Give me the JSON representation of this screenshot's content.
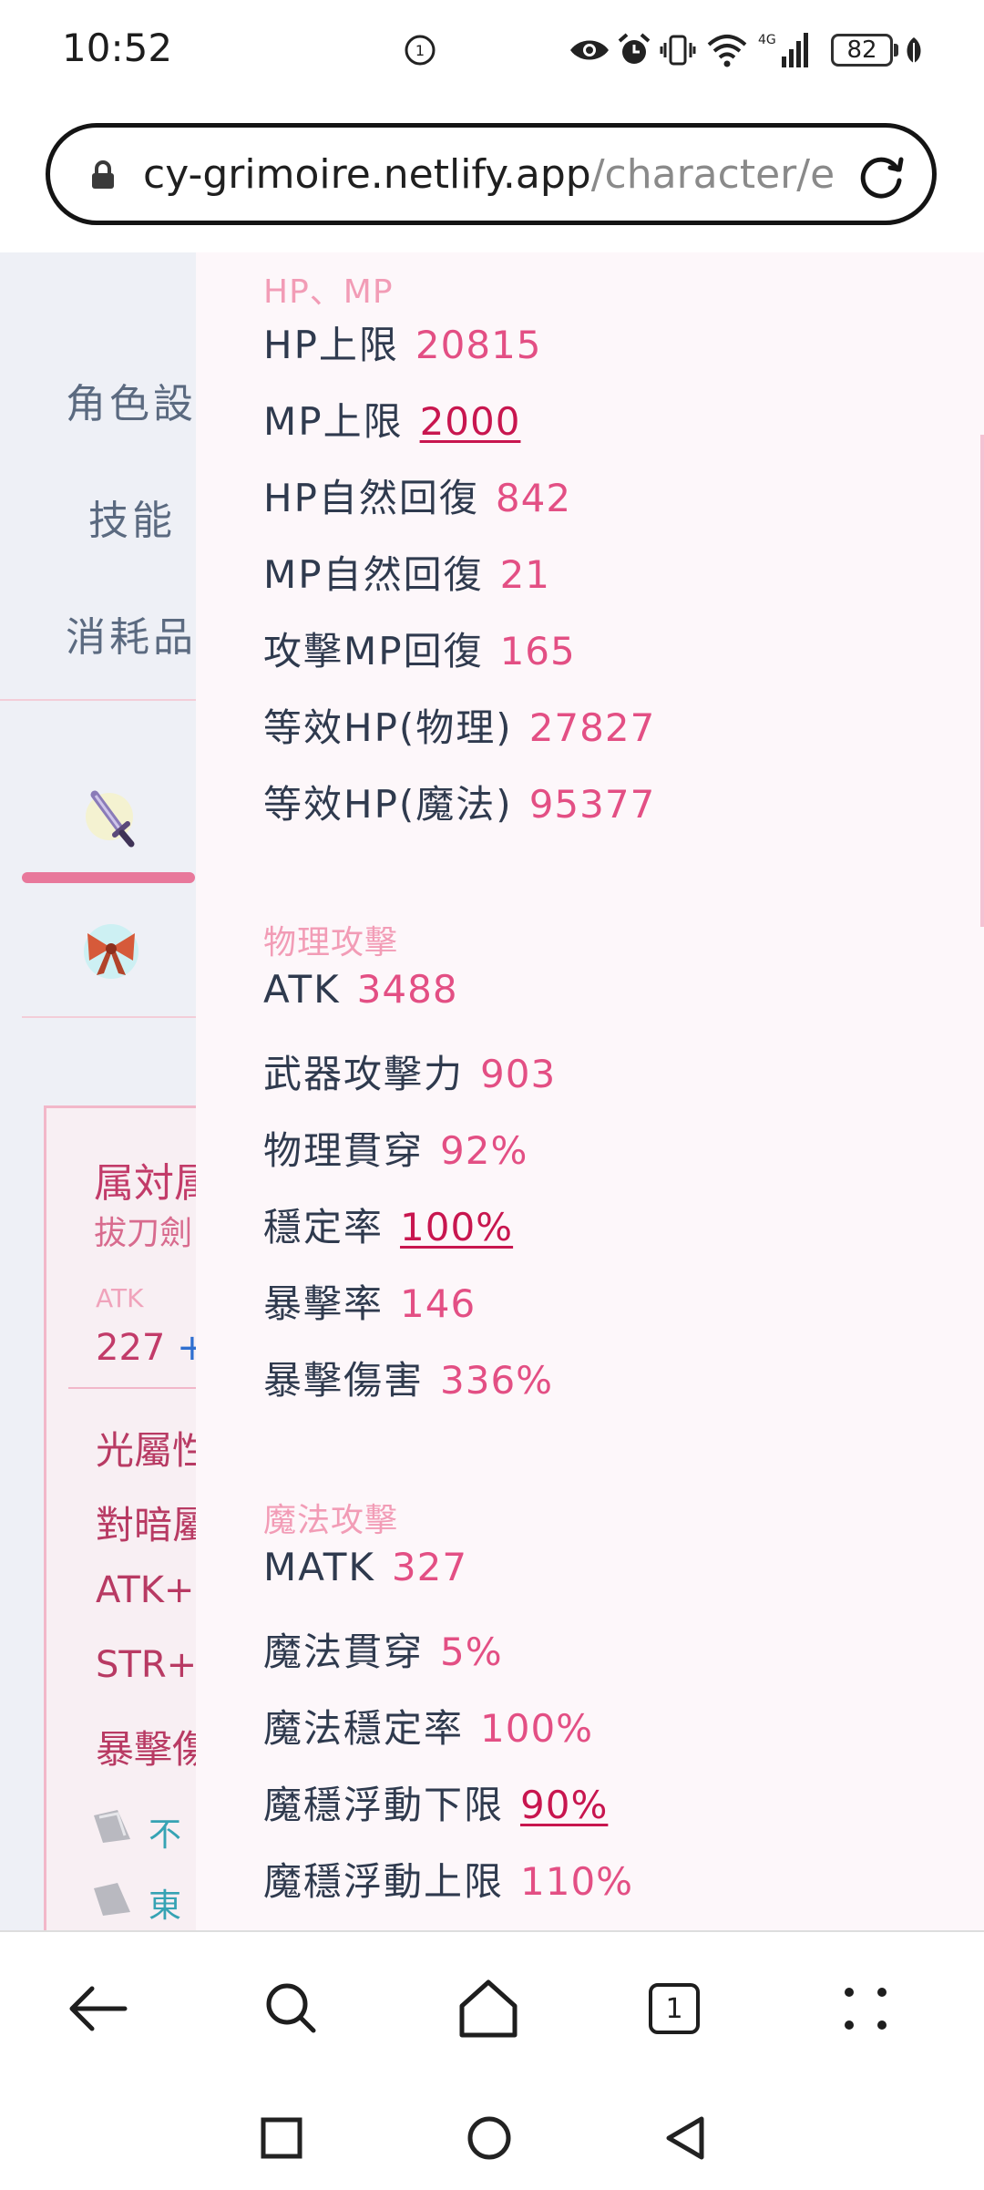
{
  "status_bar": {
    "time": "10:52",
    "battery": "82",
    "network": "4G",
    "icons": [
      "eye-icon",
      "alarm-icon",
      "vibrate-icon",
      "wifi-icon",
      "signal-icon",
      "battery-icon",
      "leaf-icon"
    ]
  },
  "browser": {
    "url_host": "cy-grimoire.netlify.app",
    "url_path": "/character/e",
    "tab_count": "1"
  },
  "nav": {
    "items": [
      "角色設",
      "技能",
      "消耗品"
    ]
  },
  "equipment_card": {
    "title": "属対属",
    "subtitle": "拔刀劍",
    "atk_label": "ATK",
    "atk_value": "227",
    "atk_plus": "+",
    "stats": [
      "光屬性",
      "對暗屬",
      "ATK+",
      "STR+",
      "暴擊傷"
    ],
    "crystals": [
      "不",
      "東"
    ]
  },
  "panel": {
    "sections": [
      {
        "title": "HP、MP",
        "rows": [
          {
            "label": "HP上限",
            "value": "20815"
          },
          {
            "label": "MP上限",
            "value": "2000",
            "link": true
          },
          {
            "label": "HP自然回復",
            "value": "842"
          },
          {
            "label": "MP自然回復",
            "value": "21"
          },
          {
            "label": "攻擊MP回復",
            "value": "165"
          },
          {
            "label": "等效HP(物理)",
            "value": "27827"
          },
          {
            "label": "等效HP(魔法)",
            "value": "95377"
          }
        ]
      },
      {
        "title": "物理攻擊",
        "rows": [
          {
            "label": "ATK",
            "value": "3488"
          },
          {
            "label": "武器攻擊力",
            "value": "903"
          },
          {
            "label": "物理貫穿",
            "value": "92%"
          },
          {
            "label": "穩定率",
            "value": "100%",
            "link": true
          },
          {
            "label": "暴擊率",
            "value": "146"
          },
          {
            "label": "暴擊傷害",
            "value": "336%"
          }
        ]
      },
      {
        "title": "魔法攻擊",
        "rows": [
          {
            "label": "MATK",
            "value": "327"
          },
          {
            "label": "魔法貫穿",
            "value": "5%"
          },
          {
            "label": "魔法穩定率",
            "value": "100%"
          },
          {
            "label": "魔穩浮動下限",
            "value": "90%",
            "link": true
          },
          {
            "label": "魔穩浮動上限",
            "value": "110%"
          }
        ]
      }
    ]
  }
}
